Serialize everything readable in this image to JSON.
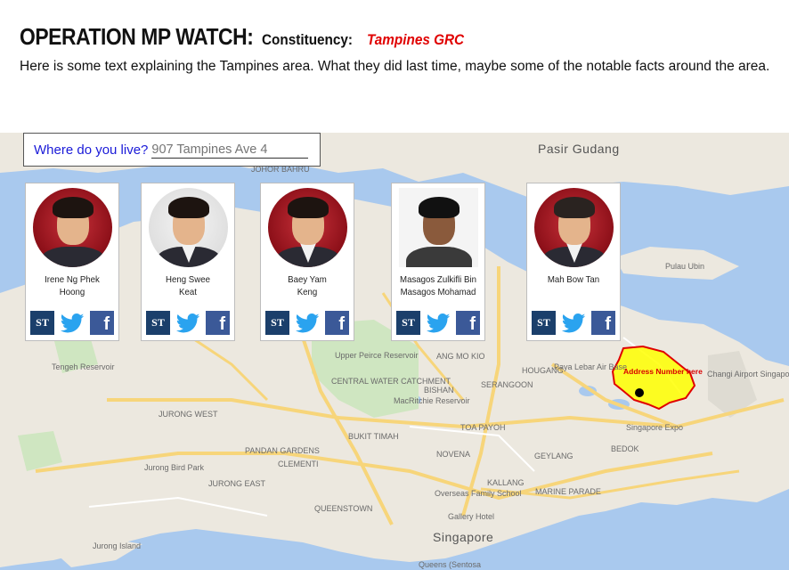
{
  "header": {
    "title": "OPERATION MP WATCH:",
    "constituency_label": "Constituency:",
    "constituency_value": "Tampines GRC",
    "intro": "Here is some text explaining the Tampines area. What they did last time, maybe some of the notable facts around the area."
  },
  "search": {
    "label": "Where do you live?",
    "placeholder": "907 Tampines Ave 4"
  },
  "mps": [
    {
      "name_line1": "Irene Ng Phek",
      "name_line2": "Hoong"
    },
    {
      "name_line1": "Heng Swee",
      "name_line2": "Keat"
    },
    {
      "name_line1": "Baey Yam",
      "name_line2": "Keng"
    },
    {
      "name_line1": "Masagos Zulkifli Bin",
      "name_line2": "Masagos Mohamad"
    },
    {
      "name_line1": "Mah Bow Tan",
      "name_line2": ""
    }
  ],
  "social": {
    "st": "ST",
    "fb": "f",
    "icons": [
      "st-icon",
      "twitter-icon",
      "facebook-icon"
    ]
  },
  "map": {
    "labels": {
      "pasir_gudang": "Pasir Gudang",
      "singapore": "Singapore",
      "changi_airport": "Changi Airport Singapore",
      "paya_lebar": "Paya Lebar Air Base",
      "singapore_expo": "Singapore Expo",
      "jurong_bird_park": "Jurong Bird Park",
      "pulau_ubin": "Pulau Ubin",
      "jurong_island": "Jurong Island",
      "overseas_family_school": "Overseas Family School",
      "gallery_hotel": "Gallery Hotel",
      "upper_peirce": "Upper Peirce Reservoir",
      "central_water": "CENTRAL WATER CATCHMENT",
      "macritchie": "MacRitchie Reservoir",
      "bukit_timah": "BUKIT TIMAH",
      "johor_bahru": "JOHOR BAHRU",
      "houga": "HOUGANG",
      "serangoon": "SERANGOON",
      "bishan": "BISHAN",
      "toa_payoh": "TOA PAYOH",
      "novena": "NOVENA",
      "geylang": "GEYLANG",
      "bedok": "BEDOK",
      "jurong_west": "JURONG WEST",
      "jurong_east": "JURONG EAST",
      "clementi": "CLEMENTI",
      "queenstown": "QUEENSTOWN",
      "ang_mo_kio": "ANG MO KIO",
      "tengeh": "Tengeh Reservoir",
      "kallang": "KALLANG",
      "marine_parade": "MARINE PARADE",
      "queens": "Queens (Sentosa",
      "pandan": "PANDAN GARDENS"
    },
    "address_marker": "Address Number here",
    "colors": {
      "water": "#a9c9ee",
      "land": "#ece8df",
      "highlight": "#ffff00",
      "highlight_border": "#e00000",
      "roads": "#f7d57a"
    }
  }
}
